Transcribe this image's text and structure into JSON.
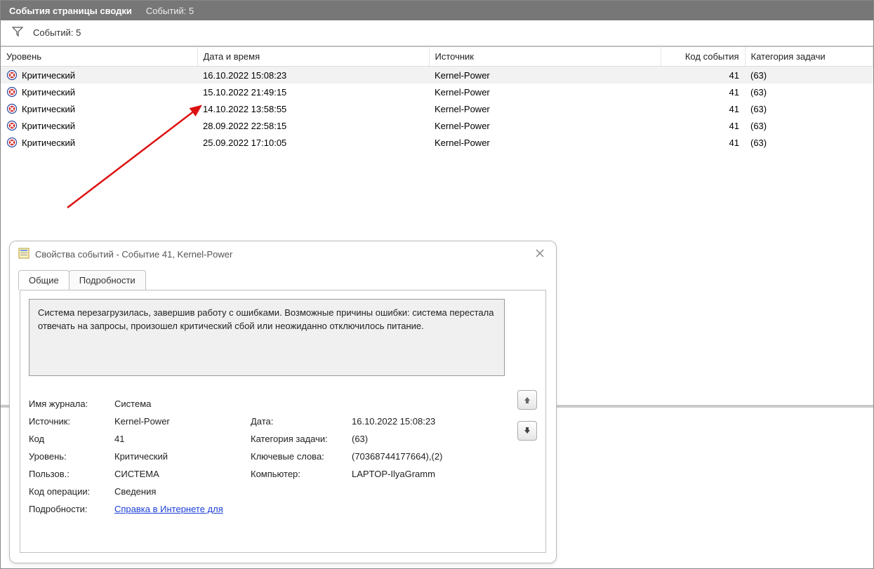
{
  "topbar": {
    "title": "События страницы сводки",
    "count_label": "Событий: 5"
  },
  "filterbar": {
    "count_label": "Событий: 5"
  },
  "columns": {
    "level": "Уровень",
    "datetime": "Дата и время",
    "source": "Источник",
    "event_id": "Код события",
    "task_cat": "Категория задачи"
  },
  "rows": [
    {
      "level": "Критический",
      "datetime": "16.10.2022 15:08:23",
      "source": "Kernel-Power",
      "event_id": "41",
      "task_cat": "(63)",
      "selected": true
    },
    {
      "level": "Критический",
      "datetime": "15.10.2022 21:49:15",
      "source": "Kernel-Power",
      "event_id": "41",
      "task_cat": "(63)"
    },
    {
      "level": "Критический",
      "datetime": "14.10.2022 13:58:55",
      "source": "Kernel-Power",
      "event_id": "41",
      "task_cat": "(63)"
    },
    {
      "level": "Критический",
      "datetime": "28.09.2022 22:58:15",
      "source": "Kernel-Power",
      "event_id": "41",
      "task_cat": "(63)"
    },
    {
      "level": "Критический",
      "datetime": "25.09.2022 17:10:05",
      "source": "Kernel-Power",
      "event_id": "41",
      "task_cat": "(63)"
    }
  ],
  "dialog": {
    "title": "Свойства событий - Событие 41, Kernel-Power",
    "tabs": {
      "general": "Общие",
      "details": "Подробности"
    },
    "description": "Система перезагрузилась, завершив работу с ошибками. Возможные причины ошибки: система перестала отвечать на запросы, произошел критический сбой или неожиданно отключилось питание.",
    "labels": {
      "log_name": "Имя журнала:",
      "source": "Источник:",
      "code": "Код",
      "level": "Уровень:",
      "user": "Пользов.:",
      "opcode": "Код операции:",
      "moreinfo": "Подробности:",
      "date": "Дата:",
      "task_cat": "Категория задачи:",
      "keywords": "Ключевые слова:",
      "computer": "Компьютер:"
    },
    "values": {
      "log_name": "Система",
      "source": "Kernel-Power",
      "code": "41",
      "level": "Критический",
      "user": "СИСТЕМА",
      "opcode": "Сведения",
      "moreinfo_link": "Справка в Интернете для ",
      "date": "16.10.2022 15:08:23",
      "task_cat": "(63)",
      "keywords": "(70368744177664),(2)",
      "computer": "LAPTOP-IlyaGramm"
    }
  }
}
